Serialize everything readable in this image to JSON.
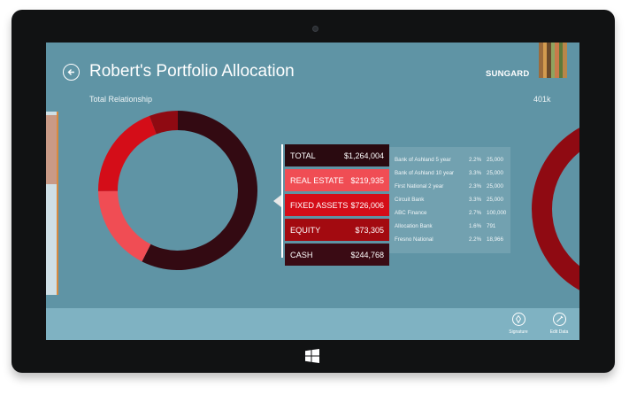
{
  "header": {
    "title": "Robert's Portfolio Allocation",
    "subtitle": "Total Relationship",
    "right_value": "401k",
    "logo_text": "SUNGARD"
  },
  "brand_stripes": [
    "#9c6b3c",
    "#d39b4f",
    "#6b4a2b",
    "#8fa35f",
    "#c97a4a",
    "#5c7a3a",
    "#b8864a"
  ],
  "allocation": [
    {
      "label": "TOTAL",
      "amount": "$1,264,004",
      "color": "#2a0a10"
    },
    {
      "label": "REAL ESTATE",
      "amount": "$219,935",
      "color": "#f04d54"
    },
    {
      "label": "FIXED ASSETS",
      "amount": "$726,006",
      "color": "#d40d18"
    },
    {
      "label": "EQUITY",
      "amount": "$73,305",
      "color": "#a30a10"
    },
    {
      "label": "CASH",
      "amount": "$244,768",
      "color": "#3a0b14"
    }
  ],
  "donut_segments": [
    {
      "name": "Real Estate",
      "value": 219935,
      "color": "#f04d54"
    },
    {
      "name": "Fixed Assets",
      "value": 726006,
      "color": "#330a12"
    },
    {
      "name": "Equity",
      "value": 73305,
      "color": "#8f0a12"
    },
    {
      "name": "Cash",
      "value": 244768,
      "color": "#d40d18"
    }
  ],
  "holdings": [
    {
      "name": "Bank of Ashland  5 year",
      "rate": "2.2%",
      "amount": "25,000"
    },
    {
      "name": "Bank of Ashland  10 year",
      "rate": "3.3%",
      "amount": "25,000"
    },
    {
      "name": "First National 2 year",
      "rate": "2.3%",
      "amount": "25,000"
    },
    {
      "name": "Circuit Bank",
      "rate": "3.3%",
      "amount": "25,000"
    },
    {
      "name": "ABC Finance",
      "rate": "2.7%",
      "amount": "100,000"
    },
    {
      "name": "Allocation Bank",
      "rate": "1.6%",
      "amount": "791"
    },
    {
      "name": "Fresno National",
      "rate": "2.2%",
      "amount": "18,966"
    }
  ],
  "app_bar": {
    "signature_label": "Signature",
    "edit_label": "Edit Data"
  }
}
